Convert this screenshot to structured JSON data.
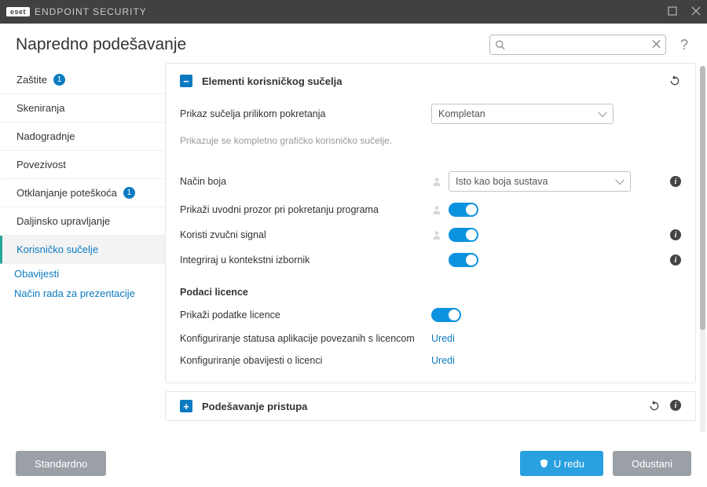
{
  "app": {
    "brand": "eset",
    "name": "ENDPOINT SECURITY"
  },
  "page_title": "Napredno podešavanje",
  "search": {
    "placeholder": ""
  },
  "sidebar": {
    "items": [
      {
        "label": "Zaštite",
        "badge": "1"
      },
      {
        "label": "Skeniranja"
      },
      {
        "label": "Nadogradnje"
      },
      {
        "label": "Povezivost"
      },
      {
        "label": "Otklanjanje poteškoća",
        "badge": "1"
      },
      {
        "label": "Daljinsko upravljanje"
      },
      {
        "label": "Korisničko sučelje",
        "active": true
      }
    ],
    "subitems": [
      {
        "label": "Obavijesti"
      },
      {
        "label": "Način rada za prezentacije"
      }
    ]
  },
  "panel1": {
    "title": "Elementi korisničkog sučelja",
    "rows": {
      "startup_display": {
        "label": "Prikaz sučelja prilikom pokretanja",
        "value": "Kompletan",
        "hint": "Prikazuje se kompletno grafičko korisničko sučelje."
      },
      "color_mode": {
        "label": "Način boja",
        "value": "Isto kao boja sustava"
      },
      "splash": {
        "label": "Prikaži uvodni prozor pri pokretanju programa"
      },
      "sound": {
        "label": "Koristi zvučni signal"
      },
      "context_menu": {
        "label": "Integriraj u kontekstni izbornik"
      }
    },
    "license": {
      "heading": "Podaci licence",
      "show": {
        "label": "Prikaži podatke licence"
      },
      "status_cfg": {
        "label": "Konfiguriranje statusa aplikacije povezanih s licencom",
        "action": "Uredi"
      },
      "notif_cfg": {
        "label": "Konfiguriranje obavijesti o licenci",
        "action": "Uredi"
      }
    }
  },
  "panel2": {
    "title": "Podešavanje pristupa"
  },
  "footer": {
    "default": "Standardno",
    "ok": "U redu",
    "cancel": "Odustani"
  }
}
